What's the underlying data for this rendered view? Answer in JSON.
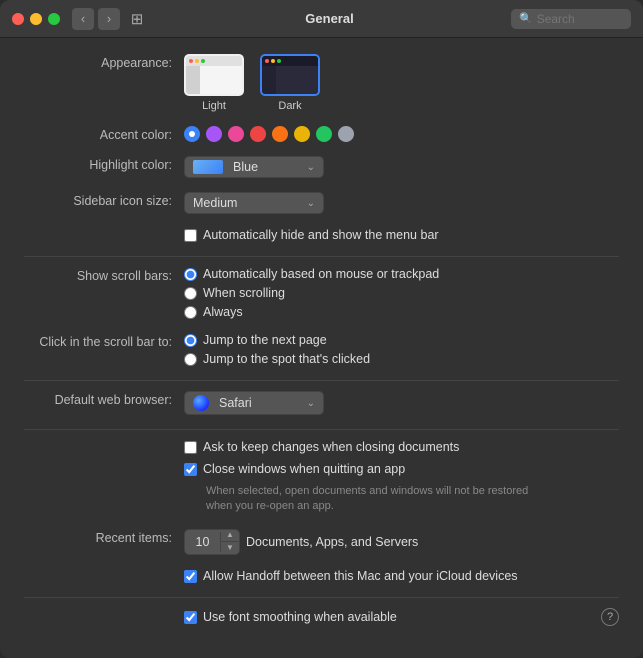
{
  "window": {
    "title": "General"
  },
  "titlebar": {
    "back_label": "‹",
    "forward_label": "›",
    "grid_label": "⊞",
    "search_placeholder": "Search"
  },
  "appearance": {
    "label": "Appearance:",
    "options": [
      {
        "id": "light",
        "label": "Light",
        "selected": false
      },
      {
        "id": "dark",
        "label": "Dark",
        "selected": true
      }
    ]
  },
  "accent_color": {
    "label": "Accent color:",
    "colors": [
      {
        "id": "blue",
        "hex": "#3b82f6",
        "selected": true
      },
      {
        "id": "purple",
        "hex": "#a855f7",
        "selected": false
      },
      {
        "id": "pink",
        "hex": "#ec4899",
        "selected": false
      },
      {
        "id": "red",
        "hex": "#ef4444",
        "selected": false
      },
      {
        "id": "orange",
        "hex": "#f97316",
        "selected": false
      },
      {
        "id": "yellow",
        "hex": "#eab308",
        "selected": false
      },
      {
        "id": "green",
        "hex": "#22c55e",
        "selected": false
      },
      {
        "id": "graphite",
        "hex": "#9ca3af",
        "selected": false
      }
    ]
  },
  "highlight_color": {
    "label": "Highlight color:",
    "value": "Blue",
    "arrow": "⌄"
  },
  "sidebar_icon_size": {
    "label": "Sidebar icon size:",
    "value": "Medium",
    "arrow": "⌄"
  },
  "menu_bar": {
    "label": "",
    "checkbox_label": "Automatically hide and show the menu bar",
    "checked": false
  },
  "show_scroll_bars": {
    "label": "Show scroll bars:",
    "options": [
      {
        "id": "auto",
        "label": "Automatically based on mouse or trackpad",
        "selected": true
      },
      {
        "id": "scrolling",
        "label": "When scrolling",
        "selected": false
      },
      {
        "id": "always",
        "label": "Always",
        "selected": false
      }
    ]
  },
  "click_scroll_bar": {
    "label": "Click in the scroll bar to:",
    "options": [
      {
        "id": "next_page",
        "label": "Jump to the next page",
        "selected": true
      },
      {
        "id": "spot",
        "label": "Jump to the spot that's clicked",
        "selected": false
      }
    ]
  },
  "default_browser": {
    "label": "Default web browser:",
    "value": "Safari",
    "arrow": "⌄"
  },
  "documents": {
    "ask_changes": {
      "label": "Ask to keep changes when closing documents",
      "checked": false
    },
    "close_windows": {
      "label": "Close windows when quitting an app",
      "checked": true,
      "sub": "When selected, open documents and windows will not be restored when you re-open an app."
    }
  },
  "recent_items": {
    "label": "Recent items:",
    "value": "10",
    "suffix": "Documents, Apps, and Servers"
  },
  "handoff": {
    "label": "Allow Handoff between this Mac and your iCloud devices",
    "checked": true
  },
  "font_smoothing": {
    "label": "Use font smoothing when available",
    "checked": true
  },
  "help_icon": "?"
}
